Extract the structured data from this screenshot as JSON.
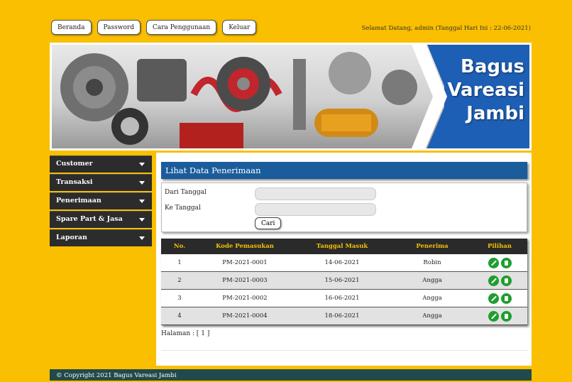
{
  "nav": {
    "items": [
      "Beranda",
      "Password",
      "Cara Penggunaan",
      "Keluar"
    ],
    "welcome": "Selamat Datang, admin (Tanggal Hari Ini : 22-06-2021)"
  },
  "banner": {
    "brand_line1": "Bagus",
    "brand_line2": "Vareasi",
    "brand_line3": "Jambi",
    "brand_color": "#1d5fb5"
  },
  "sidebar": {
    "items": [
      "Customer",
      "Transaksi",
      "Penerimaan",
      "Spare Part & Jasa",
      "Laporan"
    ],
    "caret_icon": "caret-down-icon"
  },
  "main": {
    "title": "Lihat Data Penerimaan",
    "filter": {
      "from_label": "Dari Tanggal",
      "to_label": "Ke Tanggal",
      "from_value": "",
      "to_value": "",
      "search_button": "Cari"
    },
    "table": {
      "headers": [
        "No.",
        "Kode Pemasukan",
        "Tanggal Masuk",
        "Penerima",
        "Pilihan"
      ],
      "rows": [
        {
          "no": "1",
          "kode": "PM-2021-0001",
          "tanggal": "14-06-2021",
          "penerima": "Robin"
        },
        {
          "no": "2",
          "kode": "PM-2021-0003",
          "tanggal": "15-06-2021",
          "penerima": "Angga"
        },
        {
          "no": "3",
          "kode": "PM-2021-0002",
          "tanggal": "16-06-2021",
          "penerima": "Angga"
        },
        {
          "no": "4",
          "kode": "PM-2021-0004",
          "tanggal": "18-06-2021",
          "penerima": "Angga"
        }
      ],
      "action_icons": [
        "edit-icon",
        "delete-icon"
      ],
      "header_text_color": "#f2c200"
    },
    "pagination": "Halaman : [ 1 ]"
  },
  "footer": {
    "text": "© Copyright 2021 Bagus Vareasi Jambi"
  }
}
